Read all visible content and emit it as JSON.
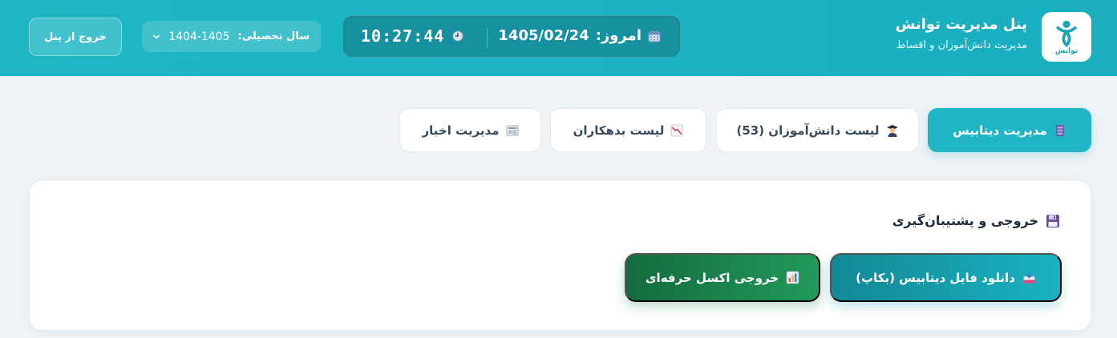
{
  "header": {
    "logo_text": "توانش",
    "title": "پنل مدیریت توانش",
    "subtitle": "مدیریت دانش‌آموزان و اقساط",
    "today_label": "امروز:",
    "today_date": "1405/02/24",
    "time": "10:27:44",
    "year_label": "سال تحصیلی:",
    "year_value": "1404-1405",
    "logout_label": "خروج از پنل"
  },
  "tabs": [
    {
      "label": "مدیریت دیتابیس",
      "icon": "database-icon",
      "active": true
    },
    {
      "label": "لیست دانش‌آموزان (53)",
      "icon": "student-icon",
      "active": false
    },
    {
      "label": "لیست بدهکاران",
      "icon": "chart-down-icon",
      "active": false
    },
    {
      "label": "مدیریت اخبار",
      "icon": "newspaper-icon",
      "active": false
    }
  ],
  "section": {
    "title": "خروجی و پشتیبان‌گیری",
    "icon": "floppy-disk-icon",
    "backup_button": "دانلود فایل دیتابیس (بکاپ)",
    "excel_button": "خروجی اکسل حرفه‌ای"
  },
  "colors": {
    "accent": "#1fb6c4",
    "datebox": "#17919f",
    "excel": "#1b8a50",
    "page_bg": "#eef3f6"
  }
}
